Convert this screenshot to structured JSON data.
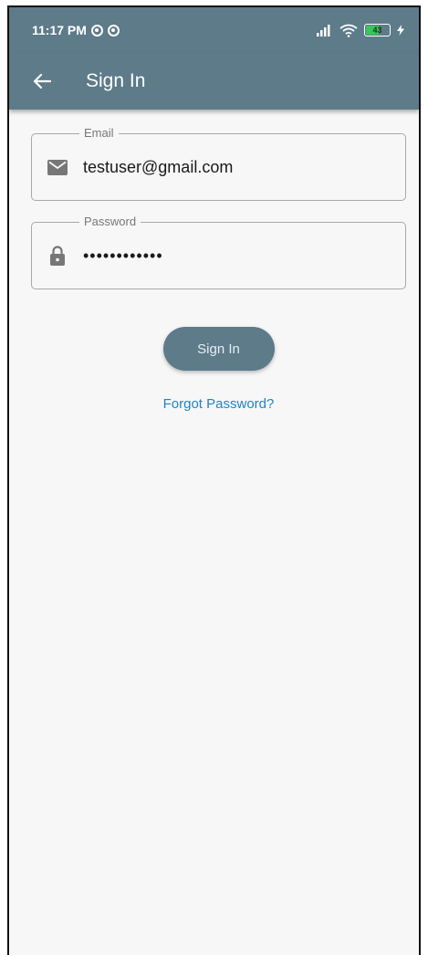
{
  "status_bar": {
    "time": "11:17 PM",
    "battery_level": "43"
  },
  "app_bar": {
    "title": "Sign In"
  },
  "form": {
    "email": {
      "label": "Email",
      "value": "testuser@gmail.com"
    },
    "password": {
      "label": "Password",
      "value": "••••••••••••"
    }
  },
  "actions": {
    "sign_in_label": "Sign In",
    "forgot_password_label": "Forgot Password?"
  },
  "colors": {
    "primary": "#5d7b89",
    "link": "#1f84c9",
    "background": "#f7f7f7"
  }
}
